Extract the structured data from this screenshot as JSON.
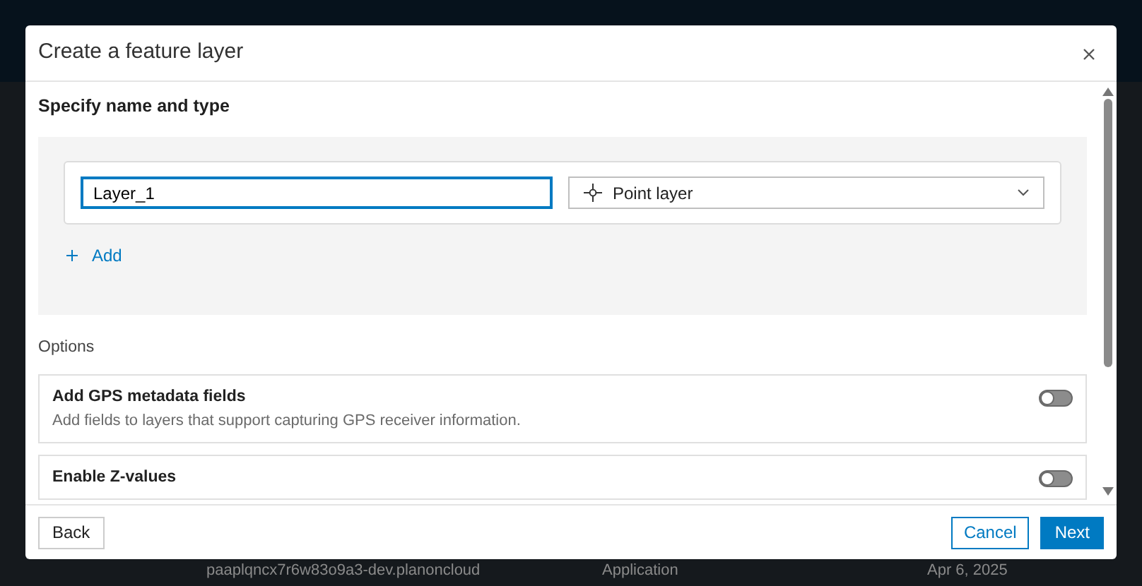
{
  "background": {
    "row": {
      "name": "paaplqncx7r6w83o9a3-dev.planoncloud",
      "type": "Application",
      "date": "Apr 6, 2025"
    }
  },
  "dialog": {
    "title": "Create a feature layer",
    "section_title": "Specify name and type",
    "layers": [
      {
        "name": "Layer_1",
        "type": "Point layer"
      }
    ],
    "add_label": "Add",
    "options_title": "Options",
    "options": [
      {
        "title": "Add GPS metadata fields",
        "description": "Add fields to layers that support capturing GPS receiver information.",
        "on": false
      },
      {
        "title": "Enable Z-values",
        "on": false
      }
    ],
    "buttons": {
      "back": "Back",
      "cancel": "Cancel",
      "next": "Next"
    }
  }
}
